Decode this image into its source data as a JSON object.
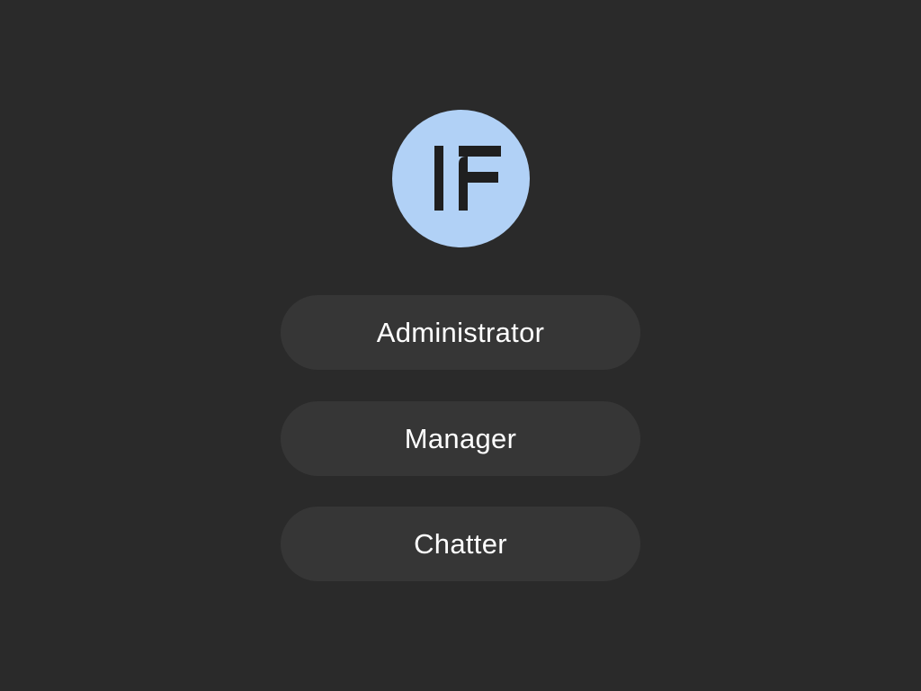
{
  "logo": {
    "icon": "if-logo-icon",
    "background_color": "#b1d1f6",
    "mark_color": "#1f1f1f"
  },
  "roles": [
    {
      "label": "Administrator"
    },
    {
      "label": "Manager"
    },
    {
      "label": "Chatter"
    }
  ],
  "colors": {
    "page_background": "#2a2a2a",
    "button_background": "#363636",
    "button_text": "#ffffff"
  }
}
